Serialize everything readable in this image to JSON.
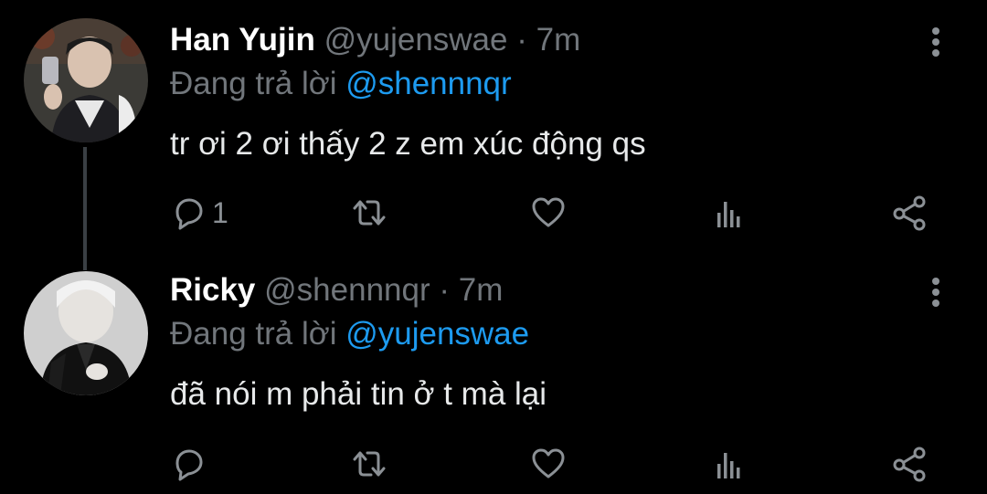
{
  "tweets": [
    {
      "display_name": "Han Yujin",
      "handle": "@yujenswae",
      "separator": "·",
      "time": "7m",
      "reply_prefix": "Đang trả lời",
      "reply_to": "@shennnqr",
      "text": "tr ơi 2 ơi thấy 2 z em xúc động qs",
      "reply_count": "1"
    },
    {
      "display_name": "Ricky",
      "handle": "@shennnqr",
      "separator": "·",
      "time": "7m",
      "reply_prefix": "Đang trả lời",
      "reply_to": "@yujenswae",
      "text": "đã nói m phải tin ở t mà lại",
      "reply_count": ""
    }
  ],
  "icons": {
    "reply": "reply-icon",
    "retweet": "retweet-icon",
    "like": "heart-icon",
    "views": "analytics-icon",
    "share": "share-icon",
    "more": "more-vertical-icon"
  },
  "colors": {
    "background": "#000000",
    "text_primary": "#e7e9ea",
    "text_secondary": "#71767b",
    "accent": "#1d9bf0",
    "thread_line": "#3a3f44"
  }
}
